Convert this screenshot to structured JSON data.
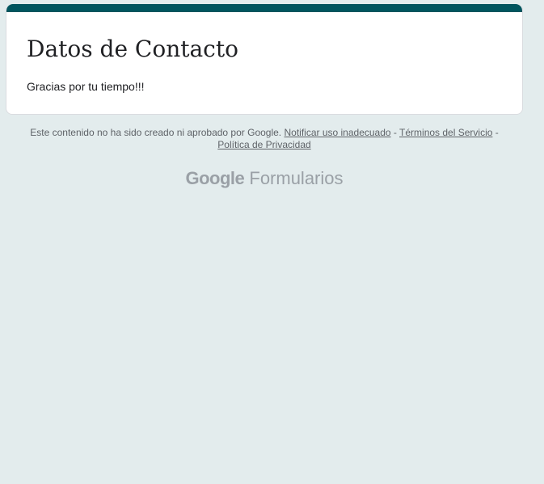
{
  "form": {
    "title": "Datos de Contacto",
    "confirmation_message": "Gracias por tu tiempo!!!",
    "accent_color": "#00555e",
    "background_color": "#e3eced"
  },
  "footer": {
    "disclaimer": "Este contenido no ha sido creado ni aprobado por Google.",
    "report_abuse": "Notificar uso inadecuado",
    "separator_1": " - ",
    "terms": "Términos del Servicio",
    "separator_2": " - ",
    "privacy": "Política de Privacidad"
  },
  "branding": {
    "company": "Google",
    "product": "Formularios"
  }
}
